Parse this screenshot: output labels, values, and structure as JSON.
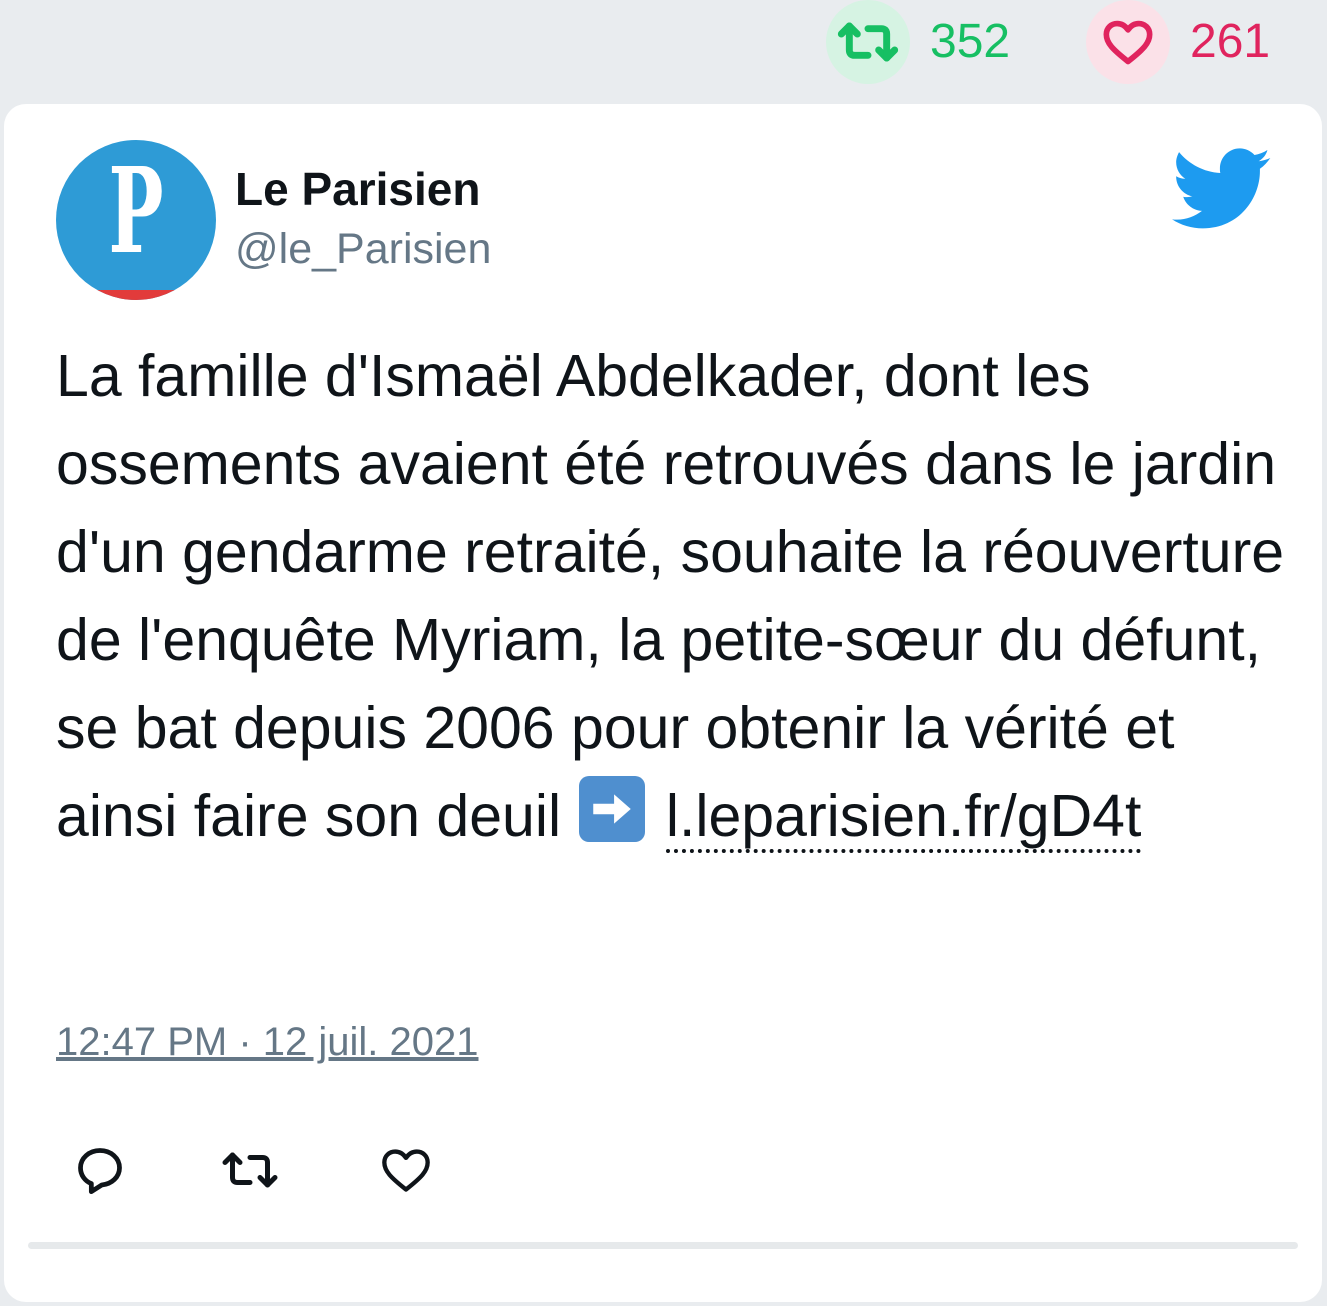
{
  "stats": {
    "retweet_icon": "retweet-icon",
    "retweet_count": "352",
    "like_icon": "heart-icon",
    "like_count": "261"
  },
  "tweet": {
    "author_name": "Le Parisien",
    "author_handle": "@le_Parisien",
    "avatar_letter": "P",
    "brand_icon": "twitter-bird-icon",
    "text": "La famille d'Ismaël Abdelkader, dont les ossements avaient été retrouvés dans le jardin d'un gendarme retraité, souhaite la réouverture de l'enquête Myriam, la petite-sœur du défunt, se bat depuis 2006 pour obtenir la vérité et ainsi faire son deuil",
    "emoji": "right-arrow-emoji",
    "link": "l.leparisien.fr/gD4t",
    "timestamp": "12:47 PM · 12 juil. 2021"
  },
  "actions": {
    "reply_icon": "reply-icon",
    "retweet_icon": "retweet-icon",
    "like_icon": "heart-icon"
  },
  "colors": {
    "retweet_green": "#17bf63",
    "like_red": "#e0245e",
    "twitter_blue": "#1d9bf0",
    "avatar_blue": "#2e9bd6",
    "avatar_red": "#e23b3b",
    "muted_gray": "#657786"
  }
}
